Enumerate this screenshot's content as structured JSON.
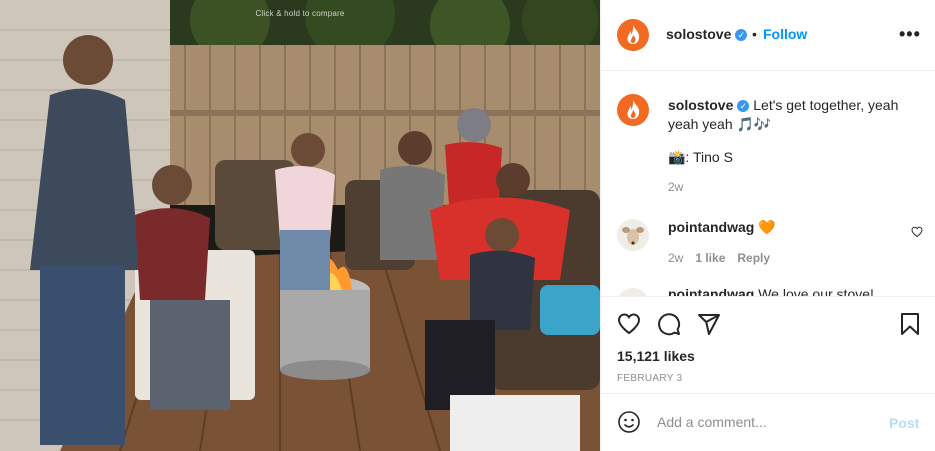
{
  "photo": {
    "hint": "Click & hold to compare"
  },
  "header": {
    "username": "solostove",
    "verified_mark": "✓",
    "separator": "•",
    "follow_label": "Follow",
    "more_label": "•••"
  },
  "caption": {
    "username": "solostove",
    "text": "Let's get together, yeah yeah yeah 🎵🎶",
    "credit": "📸: Tino S",
    "time": "2w"
  },
  "comments": [
    {
      "username": "pointandwag",
      "text": "🧡",
      "time": "2w",
      "likes": "1 like",
      "reply_label": "Reply"
    },
    {
      "username": "pointandwag",
      "text": "We love our stove!"
    }
  ],
  "actions": {
    "likes": "15,121 likes",
    "date": "FEBRUARY 3"
  },
  "add_comment": {
    "placeholder": "Add a comment...",
    "post_label": "Post"
  },
  "colors": {
    "brand_orange": "#f26a21",
    "link_blue": "#0095f6",
    "muted": "#8e8e8e",
    "post_disabled": "#b2dffc"
  },
  "icons": [
    "flame-icon",
    "verified-icon",
    "more-icon",
    "heart-icon",
    "comment-icon",
    "share-icon",
    "bookmark-icon",
    "emoji-icon"
  ]
}
